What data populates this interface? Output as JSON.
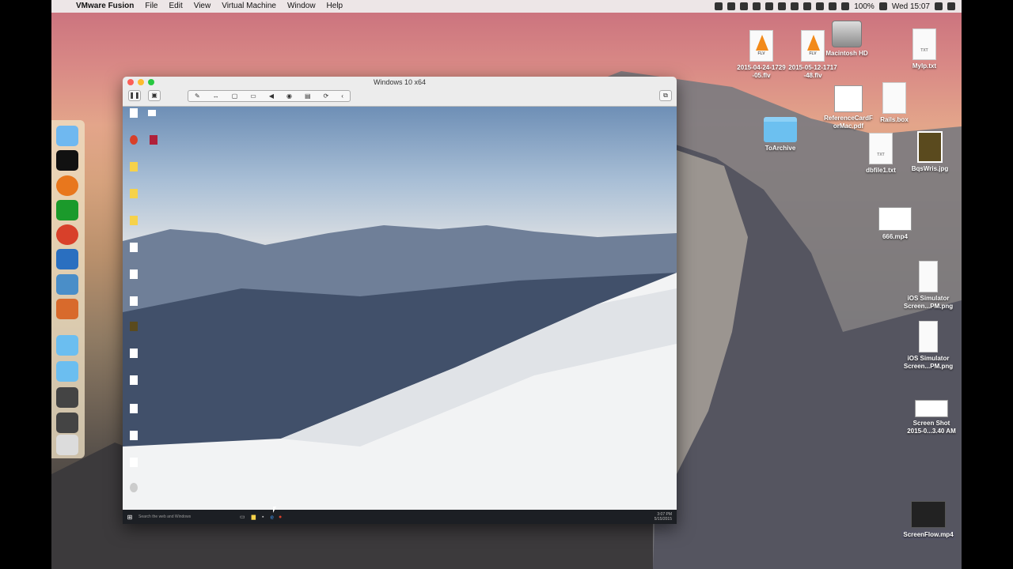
{
  "menubar": {
    "app_name": "VMware Fusion",
    "items": [
      "File",
      "Edit",
      "View",
      "Virtual Machine",
      "Window",
      "Help"
    ],
    "battery": "100%",
    "clock": "Wed 15:07",
    "status_icons": [
      "camera-icon",
      "airplay-icon",
      "info-icon",
      "dropbox-icon",
      "volume-icon",
      "clock-icon",
      "wifi-icon",
      "battery-icon",
      "spotlight-icon",
      "list-icon"
    ]
  },
  "vm_window": {
    "title": "Windows 10 x64",
    "toolbar_icons": [
      "wrench-icon",
      "arrows-icon",
      "drive-icon",
      "printer-icon",
      "speaker-icon",
      "camera-icon",
      "usb-icon",
      "sync-icon",
      "left-chevron-icon"
    ],
    "guest_taskbar": {
      "search_placeholder": "Search the web and Windows",
      "time": "3:07 PM",
      "date": "5/15/2015"
    }
  },
  "desktop_icons": [
    {
      "label": "2015-04-24-1729\n-05.flv",
      "kind": "flv"
    },
    {
      "label": "2015-05-12-1717\n-48.flv",
      "kind": "flv"
    },
    {
      "label": "Macintosh HD",
      "kind": "hd"
    },
    {
      "label": "MyIp.txt",
      "kind": "txt"
    },
    {
      "label": "ReferenceCardF\norMac.pdf",
      "kind": "pdf"
    },
    {
      "label": "Rails.box",
      "kind": "file"
    },
    {
      "label": "ToArchive",
      "kind": "folder"
    },
    {
      "label": "dbfile1.txt",
      "kind": "txt"
    },
    {
      "label": "BqsWris.jpg",
      "kind": "jpg"
    },
    {
      "label": "666.mp4",
      "kind": "video"
    },
    {
      "label": "iOS Simulator\nScreen...PM.png",
      "kind": "png"
    },
    {
      "label": "iOS Simulator\nScreen...PM.png",
      "kind": "png"
    },
    {
      "label": "Screen Shot\n2015-0...3.40 AM",
      "kind": "png"
    },
    {
      "label": "ScreenFlow.mp4",
      "kind": "video"
    }
  ],
  "dock_items": [
    "finder-icon",
    "terminal-icon",
    "firefox-icon",
    "activity-monitor-icon",
    "chrome-icon",
    "vmware-icon",
    "preview-icon",
    "sublime-icon",
    "folder-icon",
    "folder-icon",
    "screen-icon",
    "screen-icon",
    "trash-icon"
  ]
}
